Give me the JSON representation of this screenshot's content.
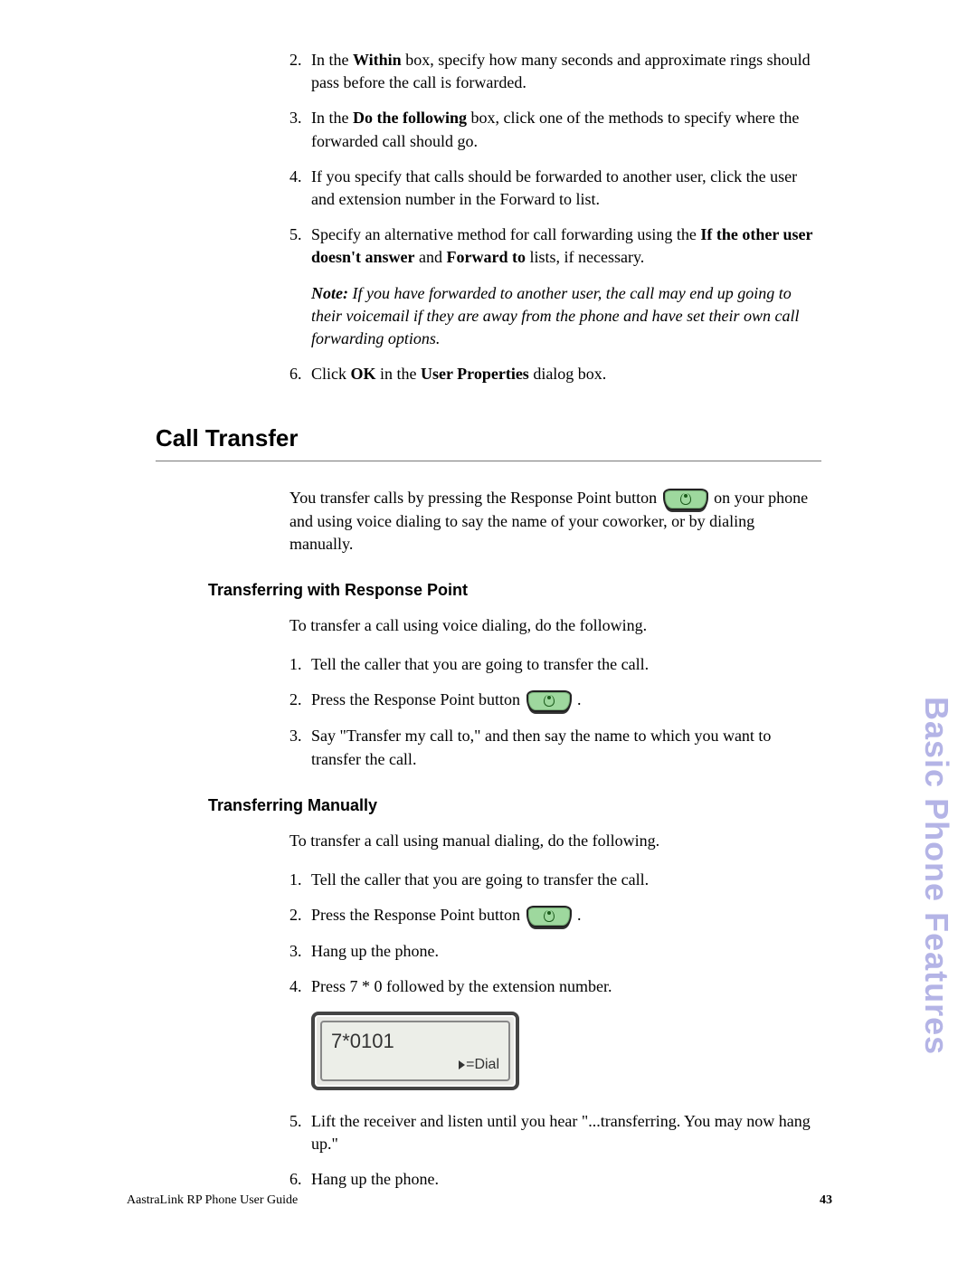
{
  "listA": {
    "item2": {
      "num": "2.",
      "pre": "In the ",
      "b1": "Within",
      "post": " box, specify how many seconds and approximate rings should pass before the call is forwarded."
    },
    "item3": {
      "num": "3.",
      "pre": "In the ",
      "b1": "Do the following",
      "post": " box, click one of the methods to specify where the forwarded call should go."
    },
    "item4": {
      "num": "4.",
      "text": "If you specify that calls should be forwarded to another user, click the user and extension number in the Forward to list."
    },
    "item5": {
      "num": "5.",
      "pre": "Specify an alternative method for call forwarding using the ",
      "b1": "If the other user doesn't answer",
      "mid": " and ",
      "b2": "Forward to",
      "post": " lists, if necessary."
    },
    "note": {
      "label": "Note:",
      "text": " If you have forwarded to another user, the call may end up going to their voicemail if they are away from the phone and have set their own call forwarding options."
    },
    "item6": {
      "num": "6.",
      "pre": "Click ",
      "b1": "OK",
      "mid": " in the ",
      "b2": "User Properties",
      "post": " dialog box."
    }
  },
  "section": {
    "title": "Call Transfer",
    "intro_pre": "You transfer calls by pressing the Response Point button ",
    "intro_post": " on your phone and using voice dialing to say the name of your coworker, or by dialing manually."
  },
  "sub1": {
    "title": "Transferring with Response Point",
    "intro": "To transfer a call using voice dialing, do the following.",
    "item1": {
      "num": "1.",
      "text": "Tell the caller that you are going to transfer the call."
    },
    "item2": {
      "num": "2.",
      "pre": "Press the Response Point button ",
      "post": " ."
    },
    "item3": {
      "num": "3.",
      "text": "Say \"Transfer my call to,\" and then say the name to which you want to transfer the call."
    }
  },
  "sub2": {
    "title": "Transferring Manually",
    "intro": "To transfer a call using manual dialing, do the following.",
    "item1": {
      "num": "1.",
      "text": "Tell the caller that you are going to transfer the call."
    },
    "item2": {
      "num": "2.",
      "pre": "Press the Response Point button ",
      "post": " ."
    },
    "item3": {
      "num": "3.",
      "text": "Hang up the phone."
    },
    "item4": {
      "num": "4.",
      "text": "Press 7 * 0 followed by the extension number."
    },
    "lcd": {
      "line1": "7*0101",
      "line2": "=Dial"
    },
    "item5": {
      "num": "5.",
      "text": "Lift the receiver and listen until you hear \"...transferring. You may now hang up.\""
    },
    "item6": {
      "num": "6.",
      "text": "Hang up the phone."
    }
  },
  "sideTab": "Basic Phone Features",
  "footer": {
    "left": "AastraLink RP Phone User Guide",
    "right": "43"
  }
}
